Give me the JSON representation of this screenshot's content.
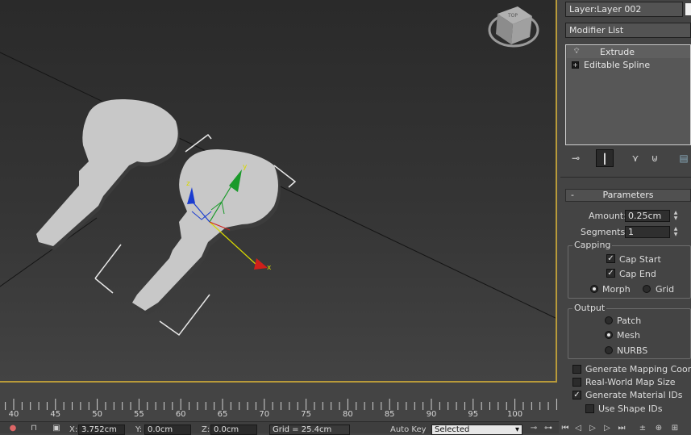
{
  "viewport": {
    "viewcube_label": "TOP",
    "axis_x": "x",
    "axis_y": "y",
    "axis_z": "z"
  },
  "trackbar": {
    "ticks": [
      "40",
      "45",
      "50",
      "55",
      "60",
      "65",
      "70",
      "75",
      "80",
      "85",
      "90",
      "95",
      "100"
    ]
  },
  "statusbar": {
    "x_label": "X:",
    "x_value": "3.752cm",
    "y_label": "Y:",
    "y_value": "0.0cm",
    "z_label": "Z:",
    "z_value": "0.0cm",
    "grid_value": "Grid = 25.4cm",
    "autokey_label": "Auto Key",
    "selected_value": "Selected"
  },
  "panel": {
    "layer_value": "Layer:Layer 002",
    "modifier_list": "Modifier List",
    "stack": [
      {
        "label": "Extrude",
        "icon": "lightbulb-icon"
      },
      {
        "label": "Editable Spline",
        "icon": "plus-icon"
      }
    ],
    "toolbar": [
      "pin-icon",
      "show-end-result-icon",
      "make-unique-icon",
      "remove-modifier-icon",
      "configure-icon"
    ],
    "parameters": {
      "title": "Parameters",
      "amount_label": "Amount:",
      "amount_value": "0.25cm",
      "segments_label": "Segments:",
      "segments_value": "1",
      "capping_title": "Capping",
      "cap_start": "Cap Start",
      "cap_start_checked": true,
      "cap_end": "Cap End",
      "cap_end_checked": true,
      "morph": "Morph",
      "grid": "Grid",
      "capping_selected": "Morph",
      "output_title": "Output",
      "patch": "Patch",
      "mesh": "Mesh",
      "nurbs": "NURBS",
      "output_selected": "Mesh",
      "gen_mapping": "Generate Mapping Coords.",
      "gen_mapping_checked": false,
      "real_world": "Real-World Map Size",
      "real_world_checked": false,
      "gen_material": "Generate Material IDs",
      "gen_material_checked": true,
      "use_shape": "Use Shape IDs",
      "use_shape_checked": false
    }
  },
  "colors": {
    "viewport_border": "#b89a3a",
    "axis_x": "#d0201a",
    "axis_y": "#1a9a2a",
    "axis_z": "#1a3cd0",
    "key_shape": "#c8c8c8"
  }
}
